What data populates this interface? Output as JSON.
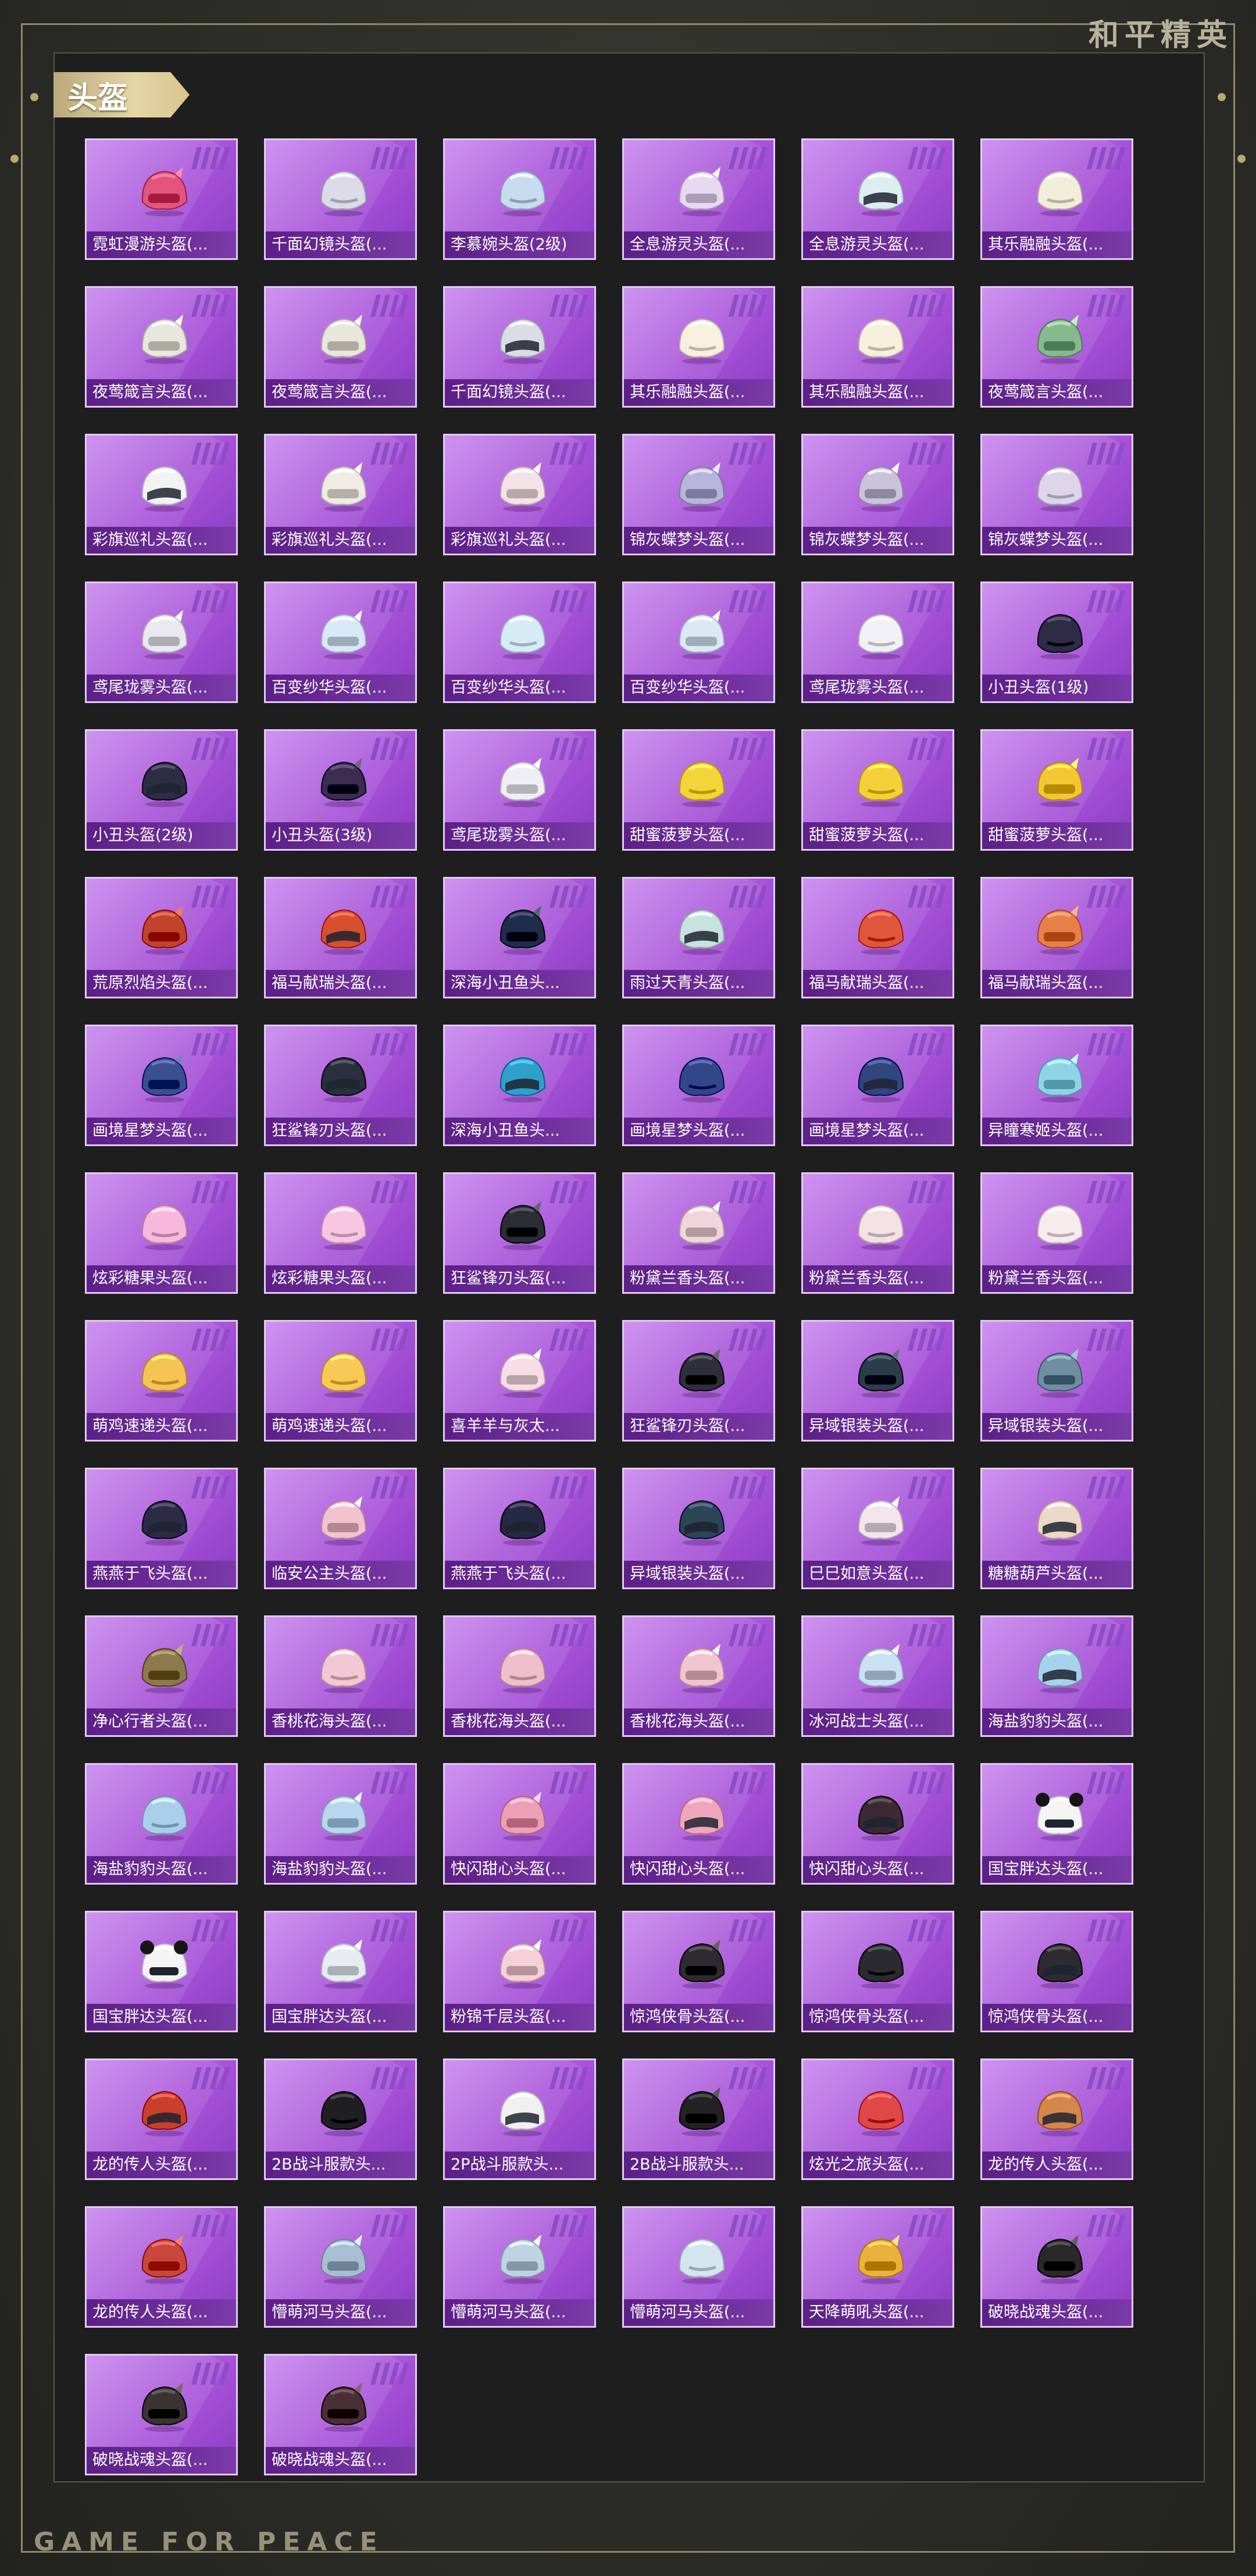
{
  "brand": "和平精英",
  "section_title": "头盔",
  "footer": "GAME FOR PEACE",
  "colors": {
    "card_purple": "#a752d8",
    "label_bar": "#5b1f87",
    "gold_tab": "#d9c48d"
  },
  "items": [
    {
      "label": "霓虹漫游头盔(...",
      "color": "#e2557c",
      "style": "robot"
    },
    {
      "label": "千面幻镜头盔(...",
      "color": "#dcdce8",
      "style": "helmet"
    },
    {
      "label": "李慕婉头盔(2级)",
      "color": "#c8dcef",
      "style": "helmet"
    },
    {
      "label": "全息游灵头盔(...",
      "color": "#e8d9f2",
      "style": "robot"
    },
    {
      "label": "全息游灵头盔(...",
      "color": "#ddeef0",
      "style": "moto"
    },
    {
      "label": "其乐融融头盔(...",
      "color": "#f3eedb",
      "style": "helmet"
    },
    {
      "label": "夜莺箴言头盔(...",
      "color": "#e7e7de",
      "style": "robot"
    },
    {
      "label": "夜莺箴言头盔(...",
      "color": "#e9e7dc",
      "style": "robot"
    },
    {
      "label": "千面幻镜头盔(...",
      "color": "#d9dde6",
      "style": "moto"
    },
    {
      "label": "其乐融融头盔(...",
      "color": "#f7f0df",
      "style": "helmet"
    },
    {
      "label": "其乐融融头盔(...",
      "color": "#f6efdc",
      "style": "helmet"
    },
    {
      "label": "夜莺箴言头盔(...",
      "color": "#87b98f",
      "style": "robot"
    },
    {
      "label": "彩旗巡礼头盔(...",
      "color": "#f2f2f2",
      "style": "moto"
    },
    {
      "label": "彩旗巡礼头盔(...",
      "color": "#f0ece4",
      "style": "robot"
    },
    {
      "label": "彩旗巡礼头盔(...",
      "color": "#f3e2e6",
      "style": "robot"
    },
    {
      "label": "锦灰蝶梦头盔(...",
      "color": "#b7b6d8",
      "style": "robot"
    },
    {
      "label": "锦灰蝶梦头盔(...",
      "color": "#c9c4db",
      "style": "robot"
    },
    {
      "label": "锦灰蝶梦头盔(...",
      "color": "#ddd6ea",
      "style": "helmet"
    },
    {
      "label": "鸢尾珑雾头盔(...",
      "color": "#ebe9f0",
      "style": "robot"
    },
    {
      "label": "百变纱华头盔(...",
      "color": "#d8e8f6",
      "style": "robot"
    },
    {
      "label": "百变纱华头盔(...",
      "color": "#d6ecf5",
      "style": "helmet"
    },
    {
      "label": "百变纱华头盔(...",
      "color": "#dbe9f5",
      "style": "robot"
    },
    {
      "label": "鸢尾珑雾头盔(...",
      "color": "#f1f0f5",
      "style": "helmet"
    },
    {
      "label": "小丑头盔(1级)",
      "color": "#2d2b45",
      "style": "helmet"
    },
    {
      "label": "小丑头盔(2级)",
      "color": "#2c2c44",
      "style": "moto"
    },
    {
      "label": "小丑头盔(3级)",
      "color": "#3b2c50",
      "style": "robot"
    },
    {
      "label": "鸢尾珑雾头盔(...",
      "color": "#eeeef4",
      "style": "robot"
    },
    {
      "label": "甜蜜菠萝头盔(...",
      "color": "#f3d43b",
      "style": "helmet"
    },
    {
      "label": "甜蜜菠萝头盔(...",
      "color": "#f5d03a",
      "style": "helmet"
    },
    {
      "label": "甜蜜菠萝头盔(...",
      "color": "#f2c733",
      "style": "robot"
    },
    {
      "label": "荒原烈焰头盔(...",
      "color": "#c2432b",
      "style": "robot"
    },
    {
      "label": "福马献瑞头盔(...",
      "color": "#d6502f",
      "style": "moto"
    },
    {
      "label": "深海小丑鱼头...",
      "color": "#1f2d4a",
      "style": "robot"
    },
    {
      "label": "雨过天青头盔(...",
      "color": "#c8e3de",
      "style": "moto"
    },
    {
      "label": "福马献瑞头盔(...",
      "color": "#e0563d",
      "style": "helmet"
    },
    {
      "label": "福马献瑞头盔(...",
      "color": "#e8804b",
      "style": "robot"
    },
    {
      "label": "画境星梦头盔(...",
      "color": "#3a4f8f",
      "style": "robot"
    },
    {
      "label": "狂鲨锋刃头盔(...",
      "color": "#2a2f3f",
      "style": "moto"
    },
    {
      "label": "深海小丑鱼头...",
      "color": "#2f9fcb",
      "style": "moto"
    },
    {
      "label": "画境星梦头盔(...",
      "color": "#34468a",
      "style": "helmet"
    },
    {
      "label": "画境星梦头盔(...",
      "color": "#31467f",
      "style": "moto"
    },
    {
      "label": "异瞳寒姬头盔(...",
      "color": "#8fd3e6",
      "style": "robot"
    },
    {
      "label": "炫彩糖果头盔(...",
      "color": "#f7b8dc",
      "style": "helmet"
    },
    {
      "label": "炫彩糖果头盔(...",
      "color": "#f9c6e2",
      "style": "helmet"
    },
    {
      "label": "狂鲨锋刃头盔(...",
      "color": "#2b2d36",
      "style": "robot"
    },
    {
      "label": "粉黛兰香头盔(...",
      "color": "#efd6da",
      "style": "robot"
    },
    {
      "label": "粉黛兰香头盔(...",
      "color": "#f3e1e3",
      "style": "helmet"
    },
    {
      "label": "粉黛兰香头盔(...",
      "color": "#f6ecee",
      "style": "helmet"
    },
    {
      "label": "萌鸡速递头盔(...",
      "color": "#f6c454",
      "style": "helmet"
    },
    {
      "label": "萌鸡速递头盔(...",
      "color": "#f7ca58",
      "style": "helmet"
    },
    {
      "label": "喜羊羊与灰太...",
      "color": "#f6dde6",
      "style": "robot"
    },
    {
      "label": "狂鲨锋刃头盔(...",
      "color": "#2d2f3a",
      "style": "robot"
    },
    {
      "label": "异域银装头盔(...",
      "color": "#2d3c4a",
      "style": "robot"
    },
    {
      "label": "异域银装头盔(...",
      "color": "#6f8fa0",
      "style": "robot"
    },
    {
      "label": "燕燕于飞头盔(...",
      "color": "#2a2b46",
      "style": "moto"
    },
    {
      "label": "临安公主头盔(...",
      "color": "#f1c3cf",
      "style": "robot"
    },
    {
      "label": "燕燕于飞头盔(...",
      "color": "#262844",
      "style": "moto"
    },
    {
      "label": "异域银装头盔(...",
      "color": "#2c4658",
      "style": "moto"
    },
    {
      "label": "巳巳如意头盔(...",
      "color": "#f2e6ec",
      "style": "robot"
    },
    {
      "label": "糖糖葫芦头盔(...",
      "color": "#ecd8c8",
      "style": "moto"
    },
    {
      "label": "净心行者头盔(...",
      "color": "#8c7a4d",
      "style": "robot"
    },
    {
      "label": "香桃花海头盔(...",
      "color": "#f3c8d2",
      "style": "helmet"
    },
    {
      "label": "香桃花海头盔(...",
      "color": "#f0bfcc",
      "style": "helmet"
    },
    {
      "label": "香桃花海头盔(...",
      "color": "#f2c6cf",
      "style": "robot"
    },
    {
      "label": "冰河战士头盔(...",
      "color": "#c9e1f2",
      "style": "robot"
    },
    {
      "label": "海盐豹豹头盔(...",
      "color": "#a8d2ea",
      "style": "moto"
    },
    {
      "label": "海盐豹豹头盔(...",
      "color": "#a9cfea",
      "style": "helmet"
    },
    {
      "label": "海盐豹豹头盔(...",
      "color": "#b8d7ee",
      "style": "robot"
    },
    {
      "label": "快闪甜心头盔(...",
      "color": "#ec9fb5",
      "style": "robot"
    },
    {
      "label": "快闪甜心头盔(...",
      "color": "#f0a7bd",
      "style": "moto"
    },
    {
      "label": "快闪甜心头盔(...",
      "color": "#3b2a33",
      "style": "moto"
    },
    {
      "label": "国宝胖达头盔(...",
      "color": "#f5f5f5",
      "style": "panda"
    },
    {
      "label": "国宝胖达头盔(...",
      "color": "#f4f4f4",
      "style": "panda"
    },
    {
      "label": "国宝胖达头盔(...",
      "color": "#e6ecf2",
      "style": "robot"
    },
    {
      "label": "粉锦千层头盔(...",
      "color": "#f4d1d6",
      "style": "robot"
    },
    {
      "label": "惊鸿侠骨头盔(...",
      "color": "#2f2a30",
      "style": "robot"
    },
    {
      "label": "惊鸿侠骨头盔(...",
      "color": "#2b2a2e",
      "style": "helmet"
    },
    {
      "label": "惊鸿侠骨头盔(...",
      "color": "#2d2b30",
      "style": "moto"
    },
    {
      "label": "龙的传人头盔(...",
      "color": "#c8402c",
      "style": "moto"
    },
    {
      "label": "2B战斗服款头...",
      "color": "#1f1f22",
      "style": "helmet"
    },
    {
      "label": "2P战斗服款头...",
      "color": "#f0f0f0",
      "style": "moto"
    },
    {
      "label": "2B战斗服款头...",
      "color": "#222225",
      "style": "robot"
    },
    {
      "label": "炫光之旅头盔(...",
      "color": "#e04848",
      "style": "helmet"
    },
    {
      "label": "龙的传人头盔(...",
      "color": "#d4874a",
      "style": "moto"
    },
    {
      "label": "龙的传人头盔(...",
      "color": "#c9473a",
      "style": "robot"
    },
    {
      "label": "懵萌河马头盔(...",
      "color": "#a9bed3",
      "style": "robot"
    },
    {
      "label": "懵萌河马头盔(...",
      "color": "#bfd3e3",
      "style": "robot"
    },
    {
      "label": "懵萌河马头盔(...",
      "color": "#d3e6f0",
      "style": "helmet"
    },
    {
      "label": "天降萌吼头盔(...",
      "color": "#e9b23c",
      "style": "robot"
    },
    {
      "label": "破晓战魂头盔(...",
      "color": "#2a2828",
      "style": "robot"
    },
    {
      "label": "破晓战魂头盔(...",
      "color": "#3b3232",
      "style": "robot"
    },
    {
      "label": "破晓战魂头盔(...",
      "color": "#4a2f36",
      "style": "robot"
    }
  ]
}
